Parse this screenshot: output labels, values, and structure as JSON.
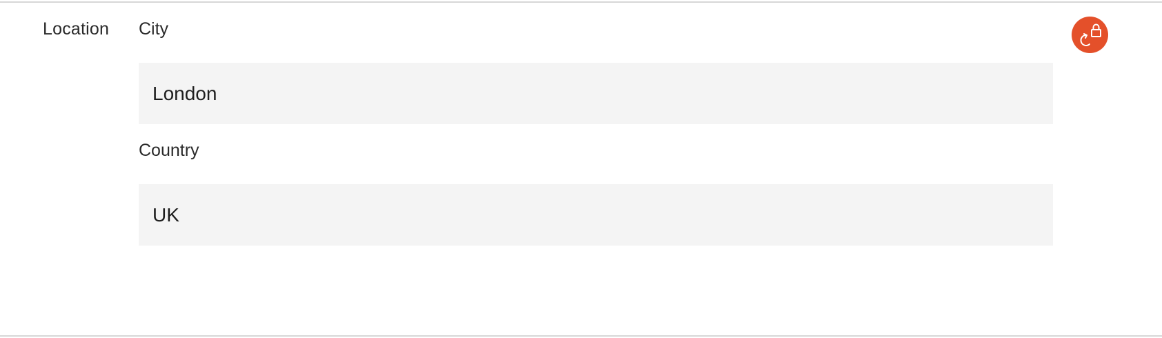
{
  "section": {
    "label": "Location"
  },
  "fields": {
    "city": {
      "label": "City",
      "value": "London"
    },
    "country": {
      "label": "Country",
      "value": "UK"
    }
  },
  "action": {
    "icon": "revert-lock-icon",
    "color": "#e4502a"
  },
  "colors": {
    "input_background": "#f4f4f4",
    "border": "#d7d7d7"
  }
}
